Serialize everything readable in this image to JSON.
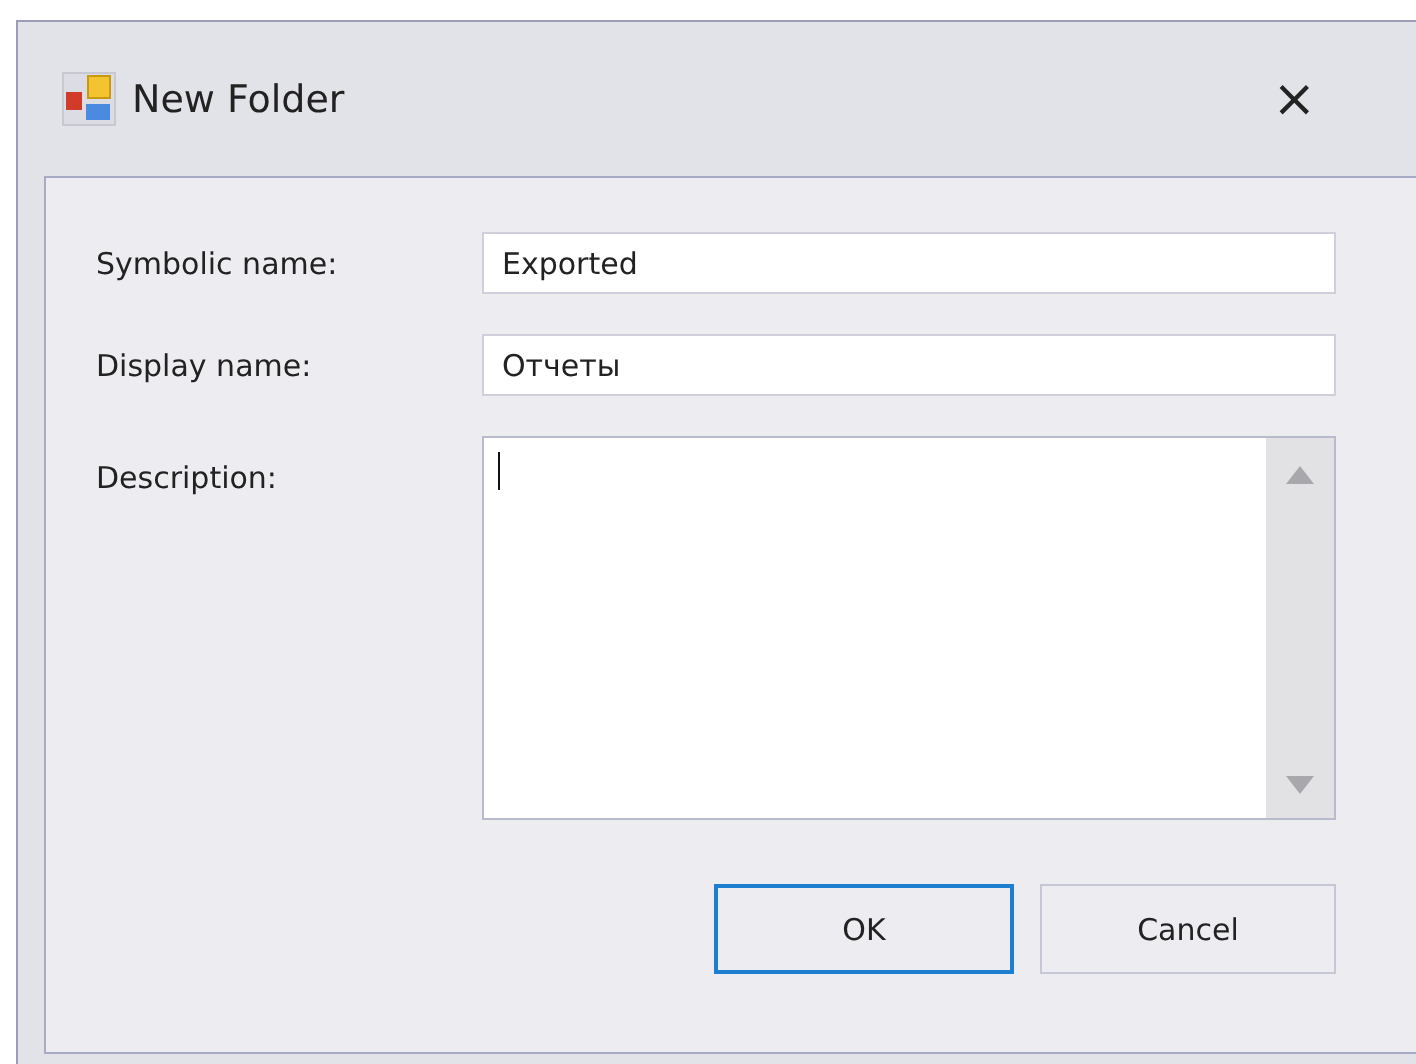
{
  "window": {
    "title": "New Folder",
    "close": "×"
  },
  "fields": [
    {
      "kind": "line",
      "label": "Symbolic name:",
      "value": "Exported",
      "focused": false
    },
    {
      "kind": "line",
      "label": "Display name:",
      "value": "Отчеты",
      "focused": false
    },
    {
      "kind": "memo",
      "label": "Description:",
      "focused": true
    }
  ],
  "buttons": [
    {
      "label": "OK",
      "focused": true
    },
    {
      "label": "Cancel",
      "focused": false
    }
  ]
}
